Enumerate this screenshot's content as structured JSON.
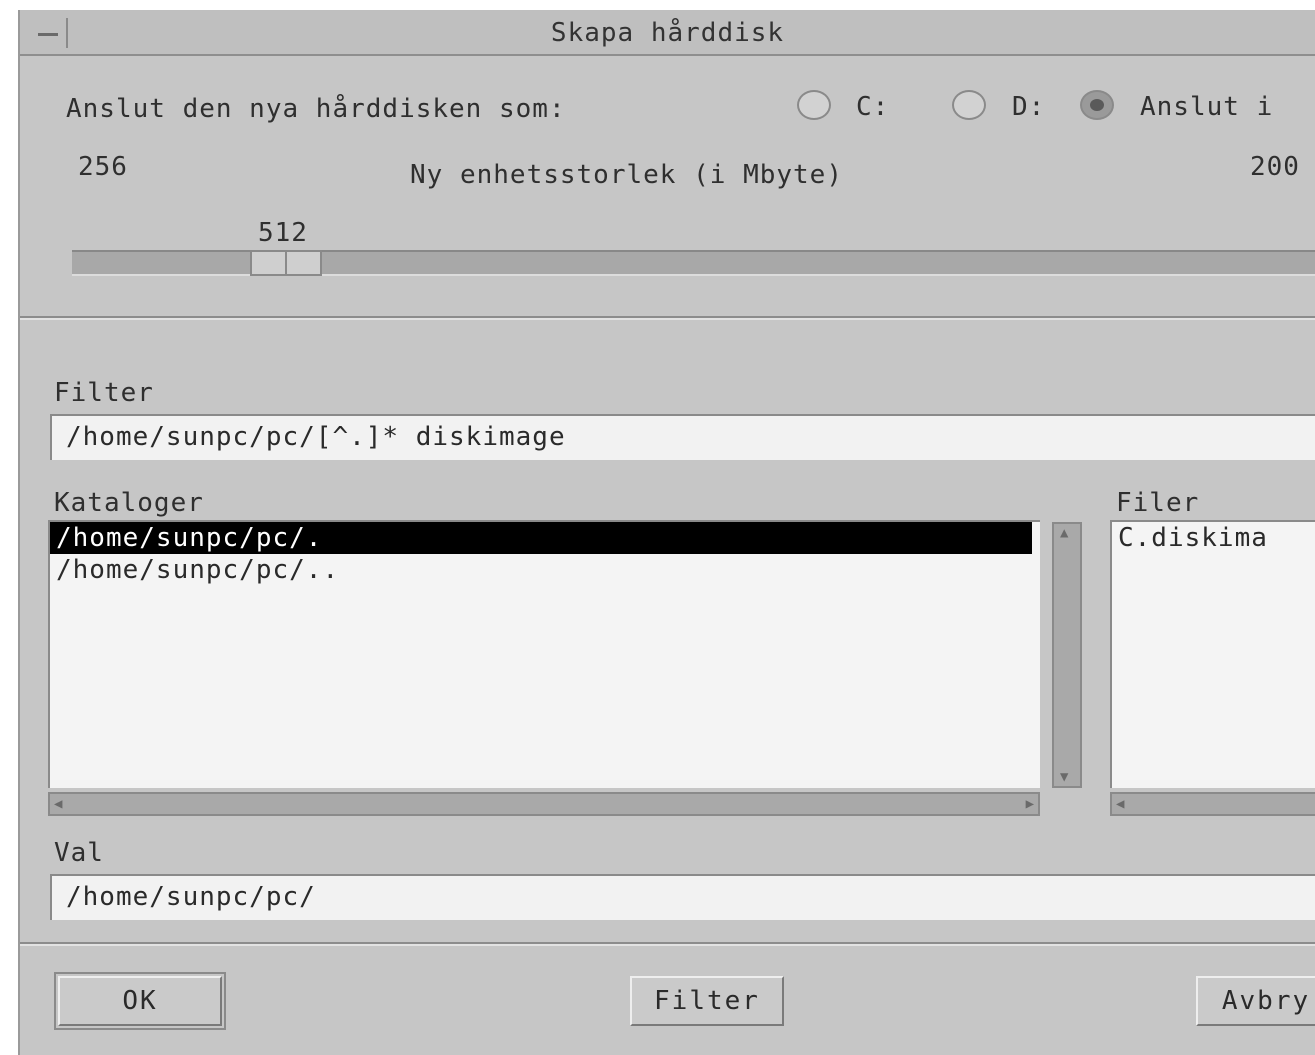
{
  "window": {
    "title": "Skapa hårddisk"
  },
  "attach": {
    "label": "Anslut den nya hårddisken som:",
    "options": [
      {
        "label": "C:",
        "selected": false
      },
      {
        "label": "D:",
        "selected": false
      },
      {
        "label": "Anslut i",
        "selected": true
      }
    ]
  },
  "size": {
    "min_label": "256",
    "max_label": "200",
    "caption": "Ny enhetsstorlek (i Mbyte)",
    "value": "512"
  },
  "filter": {
    "label": "Filter",
    "value": "/home/sunpc/pc/[^.]* diskimage"
  },
  "directories": {
    "label": "Kataloger",
    "items": [
      "/home/sunpc/pc/.",
      "/home/sunpc/pc/.."
    ],
    "selected_index": 0
  },
  "files": {
    "label": "Filer",
    "items": [
      "C.diskima"
    ]
  },
  "selection": {
    "label": "Val",
    "value": "/home/sunpc/pc/"
  },
  "buttons": {
    "ok": "OK",
    "filter": "Filter",
    "cancel": "Avbry"
  }
}
